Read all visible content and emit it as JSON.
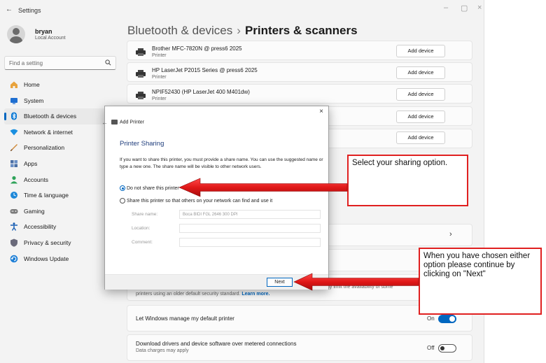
{
  "window": {
    "back_glyph": "←",
    "title": "Settings",
    "minimize_glyph": "–",
    "maximize_glyph": "▢",
    "close_glyph": "×"
  },
  "profile": {
    "name": "bryan",
    "subtitle": "Local Account"
  },
  "search": {
    "placeholder": "Find a setting",
    "icon": "search-icon"
  },
  "sidebar": {
    "items": [
      {
        "label": "Home",
        "icon": "home-icon",
        "color": "#e8a33d"
      },
      {
        "label": "System",
        "icon": "system-icon",
        "color": "#1f6fd1"
      },
      {
        "label": "Bluetooth & devices",
        "icon": "bluetooth-icon",
        "color": "#0a78d4",
        "active": true
      },
      {
        "label": "Network & internet",
        "icon": "wifi-icon",
        "color": "#1a8fe0"
      },
      {
        "label": "Personalization",
        "icon": "brush-icon",
        "color": "#d08a3a"
      },
      {
        "label": "Apps",
        "icon": "apps-icon",
        "color": "#4a6fa5"
      },
      {
        "label": "Accounts",
        "icon": "accounts-icon",
        "color": "#2fa35a"
      },
      {
        "label": "Time & language",
        "icon": "globe-clock-icon",
        "color": "#1e88d8"
      },
      {
        "label": "Gaming",
        "icon": "gamepad-icon",
        "color": "#7a7a7a"
      },
      {
        "label": "Accessibility",
        "icon": "accessibility-icon",
        "color": "#1a5fb4"
      },
      {
        "label": "Privacy & security",
        "icon": "shield-icon",
        "color": "#6a6a7a"
      },
      {
        "label": "Windows Update",
        "icon": "update-icon",
        "color": "#1e7fd6"
      }
    ]
  },
  "header": {
    "breadcrumb": "Bluetooth & devices",
    "separator": "›",
    "title": "Printers & scanners"
  },
  "printers": [
    {
      "name": "Brother MFC-7820N @ press6 2025",
      "type": "Printer",
      "button": "Add device"
    },
    {
      "name": "HP LaserJet P2015 Series @ press6 2025",
      "type": "Printer",
      "button": "Add device"
    },
    {
      "name": "NPIF52430 (HP LaserJet 400 M401dw)",
      "type": "Printer",
      "button": "Add device"
    },
    {
      "name": "",
      "type": "",
      "button": "Add device"
    },
    {
      "name": "",
      "type": "",
      "button": "Add device"
    }
  ],
  "chevron": "›",
  "legacy_row": {
    "text_start": "printers using an older default security standard.",
    "link": "Learn more.",
    "text_right": "ay limit the availability of some"
  },
  "let_windows": {
    "label": "Let Windows manage my default printer",
    "state": "On"
  },
  "metered": {
    "label": "Download drivers and device software over metered connections",
    "sub": "Data charges may apply",
    "state": "Off"
  },
  "dialog": {
    "close_glyph": "×",
    "back_glyph": "←",
    "title": "Add Printer",
    "heading": "Printer Sharing",
    "description": "If you want to share this printer, you must provide a share name. You can use the suggested name or type a new one. The share name will be visible to other network users.",
    "option_no_share": "Do not share this printer",
    "option_share": "Share this printer so that others on your network can find and use it",
    "share_name_label": "Share name:",
    "share_name_value": "Boca BIDI FGL 2646 300 DPI",
    "location_label": "Location:",
    "location_value": "",
    "comment_label": "Comment:",
    "comment_value": "",
    "next_button": "Next"
  },
  "callouts": {
    "sharing": "Select your sharing option.",
    "next": "When you have chosen either option please continue by clicking on \"Next\""
  },
  "colors": {
    "accent": "#0067c0",
    "annotation_red": "#e02020",
    "dialog_heading": "#1e3c7b"
  }
}
